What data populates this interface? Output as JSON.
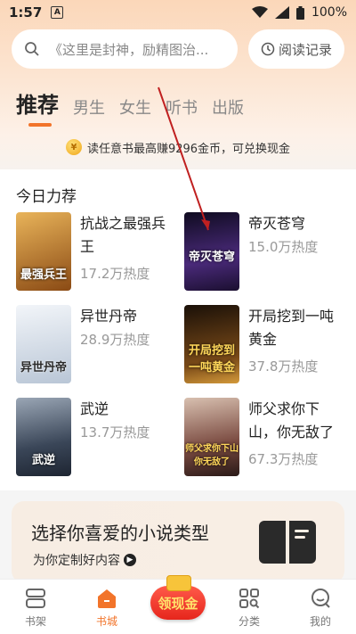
{
  "status_bar": {
    "time": "1:57",
    "notif_icon": "A",
    "battery": "100%"
  },
  "search": {
    "placeholder": "《这里是封神，励精图治...",
    "history_label": "阅读记录"
  },
  "tabs": [
    {
      "label": "推荐",
      "active": true
    },
    {
      "label": "男生"
    },
    {
      "label": "女生"
    },
    {
      "label": "听书"
    },
    {
      "label": "出版"
    }
  ],
  "promo": {
    "text": "读任意书最高赚9296金币，可兑换现金"
  },
  "section": {
    "title": "今日力荐"
  },
  "books": [
    {
      "title": "抗战之最强兵王",
      "heat": "17.2万热度",
      "cover_text": "最强兵王",
      "color": "#c8892a"
    },
    {
      "title": "帝灭苍穹",
      "heat": "15.0万热度",
      "cover_text": "帝灭苍穹",
      "color": "#2b1d4a"
    },
    {
      "title": "异世丹帝",
      "heat": "28.9万热度",
      "cover_text": "异世丹帝",
      "color": "#dfe6ee"
    },
    {
      "title": "开局挖到一吨黄金",
      "heat": "37.8万热度",
      "cover_text": "开局挖到一吨黄金",
      "color": "#3a2410"
    },
    {
      "title": "武逆",
      "heat": "13.7万热度",
      "cover_text": "武逆",
      "color": "#3a4658"
    },
    {
      "title": "师父求你下山，你无敌了",
      "heat": "67.3万热度",
      "cover_text": "师父求你下山你无敌了",
      "color": "#5a3a34"
    }
  ],
  "genre_card": {
    "title": "选择你喜爱的小说类型",
    "subtitle": "为你定制好内容"
  },
  "nav": [
    {
      "label": "书架",
      "icon": "bookshelf-icon"
    },
    {
      "label": "书城",
      "icon": "home-icon",
      "active": true
    },
    {
      "label": "领现金",
      "icon": "cash-icon"
    },
    {
      "label": "分类",
      "icon": "category-icon"
    },
    {
      "label": "我的",
      "icon": "profile-icon"
    }
  ],
  "colors": {
    "accent": "#f2742a"
  }
}
